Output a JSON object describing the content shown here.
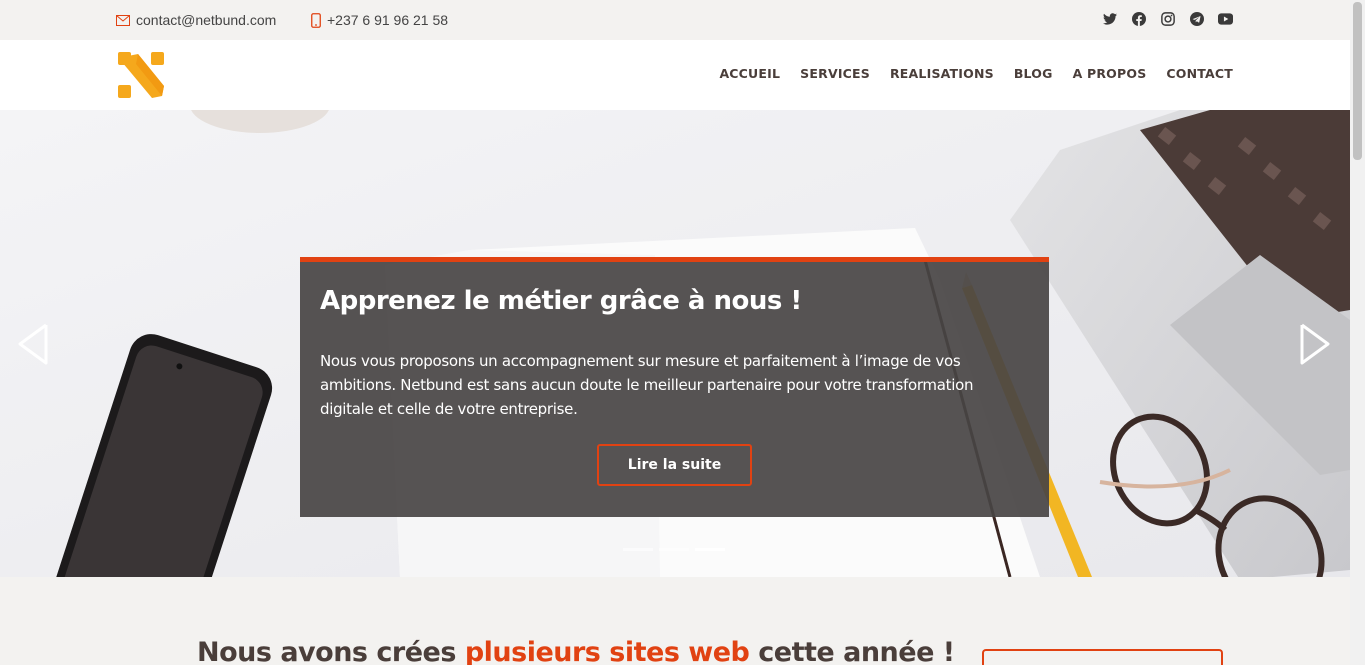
{
  "topbar": {
    "email": "contact@netbund.com",
    "phone": "+237 6 91 96 21 58",
    "socials": [
      "twitter-icon",
      "facebook-icon",
      "instagram-icon",
      "telegram-icon",
      "youtube-icon"
    ]
  },
  "nav": {
    "items": [
      "ACCUEIL",
      "SERVICES",
      "REALISATIONS",
      "BLOG",
      "A PROPOS",
      "CONTACT"
    ]
  },
  "hero": {
    "title": "Apprenez le métier grâce à nous !",
    "text": "Nous vous proposons un accompagnement sur mesure et parfaitement à l’image de vos ambitions. Netbund est sans aucun doute le meilleur partenaire pour votre transformation digitale et celle de votre entreprise.",
    "cta": "Lire la suite",
    "slides_total": 3,
    "active_slide": 3
  },
  "section": {
    "heading_start": "Nous avons crées ",
    "heading_accent": "plusieurs sites web",
    "heading_end": " cette année !"
  },
  "colors": {
    "accent": "#e14212",
    "logo": "#f5a81c",
    "text_dark": "#4a3e3a",
    "caption_bg": "#484444"
  }
}
